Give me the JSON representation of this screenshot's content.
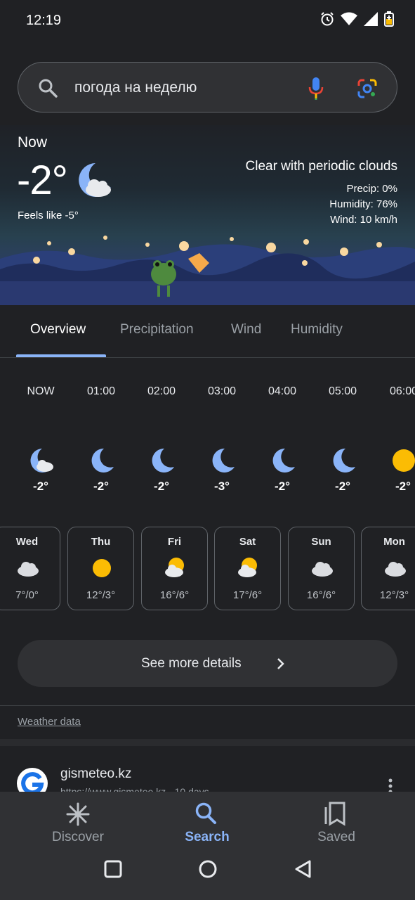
{
  "status": {
    "time": "12:19"
  },
  "search": {
    "query": "погода на неделю"
  },
  "hero": {
    "now_label": "Now",
    "temperature": "-2°",
    "feels_like": "Feels like -5°",
    "condition": "Clear with periodic clouds",
    "precip": "Precip: 0%",
    "humidity": "Humidity: 76%",
    "wind": "Wind: 10 km/h"
  },
  "tabs": [
    {
      "label": "Overview",
      "active": true
    },
    {
      "label": "Precipitation",
      "active": false
    },
    {
      "label": "Wind",
      "active": false
    },
    {
      "label": "Humidity",
      "active": false
    }
  ],
  "hourly": [
    {
      "time": "NOW",
      "icon": "moon-cloud-icon",
      "temp": "-2°"
    },
    {
      "time": "01:00",
      "icon": "moon-icon",
      "temp": "-2°"
    },
    {
      "time": "02:00",
      "icon": "moon-icon",
      "temp": "-2°"
    },
    {
      "time": "03:00",
      "icon": "moon-icon",
      "temp": "-3°"
    },
    {
      "time": "04:00",
      "icon": "moon-icon",
      "temp": "-2°"
    },
    {
      "time": "05:00",
      "icon": "moon-icon",
      "temp": "-2°"
    },
    {
      "time": "06:00",
      "icon": "sun-icon",
      "temp": "-2°"
    }
  ],
  "daily": [
    {
      "day": "Wed",
      "icon": "cloud-icon",
      "temps": "7°/0°"
    },
    {
      "day": "Thu",
      "icon": "sun-icon",
      "temps": "12°/3°"
    },
    {
      "day": "Fri",
      "icon": "sun-cloud-icon",
      "temps": "16°/6°"
    },
    {
      "day": "Sat",
      "icon": "sun-cloud-icon",
      "temps": "17°/6°"
    },
    {
      "day": "Sun",
      "icon": "cloud-icon",
      "temps": "16°/6°"
    },
    {
      "day": "Mon",
      "icon": "cloud-icon",
      "temps": "12°/3°"
    }
  ],
  "details_button": "See more details",
  "weather_data_link": "Weather data",
  "result": {
    "site": "gismeteo.kz",
    "url": "https://www.gismeteo.kz · 10 days"
  },
  "bottom_nav": [
    {
      "label": "Discover",
      "icon": "discover-icon"
    },
    {
      "label": "Search",
      "icon": "search-icon"
    },
    {
      "label": "Saved",
      "icon": "saved-icon"
    }
  ],
  "colors": {
    "accent": "#8ab4f8",
    "background": "#202124",
    "surface": "#303134",
    "sun": "#fbbc04"
  }
}
